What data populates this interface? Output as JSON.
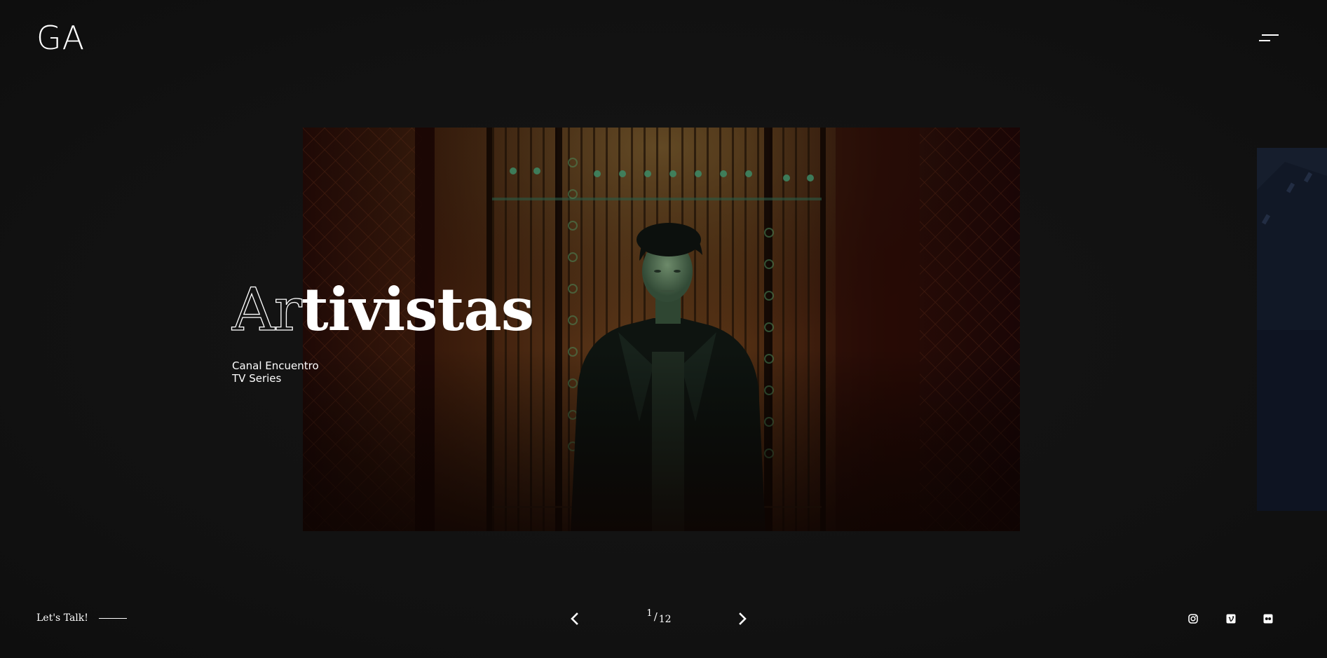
{
  "header": {
    "logo": "GA",
    "menu_icon": "hamburger-menu-icon"
  },
  "slide": {
    "title_outline": "Ar",
    "title_solid": "tivistas",
    "client": "Canal Encuentro",
    "category": "TV Series"
  },
  "footer": {
    "cta_label": "Let's Talk!",
    "current_page": "1",
    "separator": "/",
    "total_pages": "12",
    "prev_icon": "chevron-left-icon",
    "next_icon": "chevron-right-icon",
    "social": [
      {
        "name": "instagram",
        "icon": "instagram-icon"
      },
      {
        "name": "vimeo",
        "icon": "vimeo-icon"
      },
      {
        "name": "flickr",
        "icon": "flickr-icon"
      }
    ]
  },
  "colors": {
    "background": "#121212",
    "text": "#ffffff",
    "image_warm": "#3b1a07",
    "image_green": "#2c5a3a",
    "peek_blue": "#1a2232"
  }
}
